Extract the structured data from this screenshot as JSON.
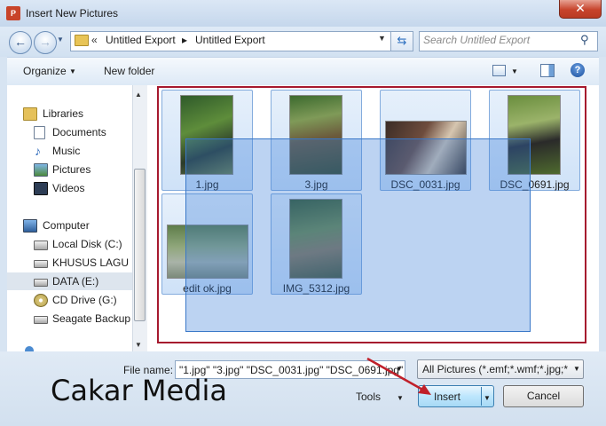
{
  "window": {
    "title": "Insert New Pictures",
    "close_glyph": "✕"
  },
  "address": {
    "prefix": "«",
    "crumbs": [
      "Untitled Export",
      "Untitled Export"
    ],
    "separator": "▸"
  },
  "search": {
    "placeholder": "Search Untitled Export"
  },
  "toolbar": {
    "organize": "Organize",
    "new_folder": "New folder"
  },
  "nav": {
    "items": [
      {
        "label": "Libraries"
      },
      {
        "label": "Documents"
      },
      {
        "label": "Music"
      },
      {
        "label": "Pictures"
      },
      {
        "label": "Videos"
      },
      {
        "label": "Computer"
      },
      {
        "label": "Local Disk (C:)"
      },
      {
        "label": "KHUSUS LAGU (D"
      },
      {
        "label": "DATA (E:)"
      },
      {
        "label": "CD Drive (G:)"
      },
      {
        "label": "Seagate Backup P"
      }
    ]
  },
  "files": [
    {
      "name": "1.jpg"
    },
    {
      "name": "3.jpg"
    },
    {
      "name": "DSC_0031.jpg"
    },
    {
      "name": "DSC_0691.jpg"
    },
    {
      "name": "edit ok.jpg"
    },
    {
      "name": "IMG_5312.jpg"
    }
  ],
  "bottom": {
    "file_name_label": "File name:",
    "file_name_value": "\"1.jpg\" \"3.jpg\" \"DSC_0031.jpg\" \"DSC_0691.jpg\"",
    "filter": "All Pictures (*.emf;*.wmf;*.jpg;*",
    "tools": "Tools",
    "insert": "Insert",
    "cancel": "Cancel"
  },
  "watermark": "Cakar Media",
  "colors": {
    "highlight_frame": "#a6192e",
    "selection": "#3378d7",
    "arrow": "#c0202a"
  }
}
